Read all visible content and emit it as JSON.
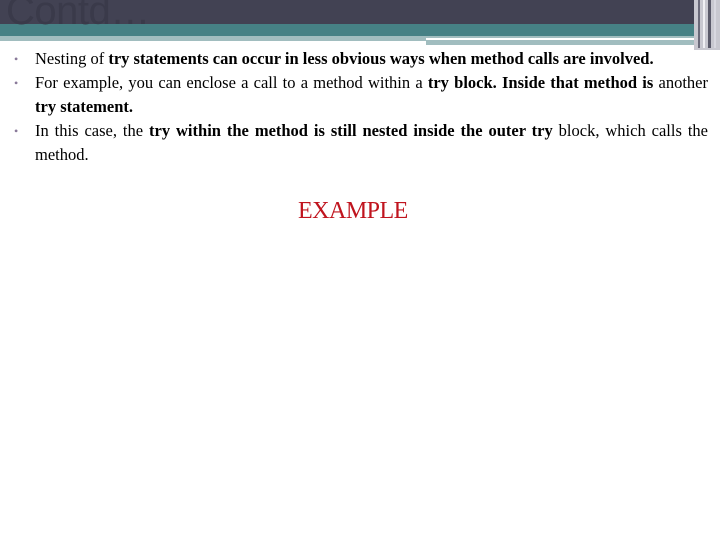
{
  "slide": {
    "title": "Contd…",
    "bullets": [
      {
        "parts": [
          {
            "text": "Nesting of ",
            "bold": false
          },
          {
            "text": "try statements can occur in less obvious ways when method calls are involved.",
            "bold": true
          }
        ]
      },
      {
        "parts": [
          {
            "text": "For example, you can enclose a call to a method within a ",
            "bold": false
          },
          {
            "text": "try block. Inside that method is ",
            "bold": true
          },
          {
            "text": "another ",
            "bold": false
          },
          {
            "text": "try statement.",
            "bold": true
          }
        ]
      },
      {
        "parts": [
          {
            "text": "In this case, the ",
            "bold": false
          },
          {
            "text": "try within the method is still nested inside the outer try",
            "bold": true
          },
          {
            "text": " block, which calls the method.",
            "bold": false
          }
        ]
      }
    ],
    "example_label": "EXAMPLE"
  },
  "colors": {
    "header_dark": "#424253",
    "header_teal": "#468185",
    "header_light": "#a1bdbf",
    "bullet": "#8a7a9a",
    "example": "#c0141e"
  }
}
